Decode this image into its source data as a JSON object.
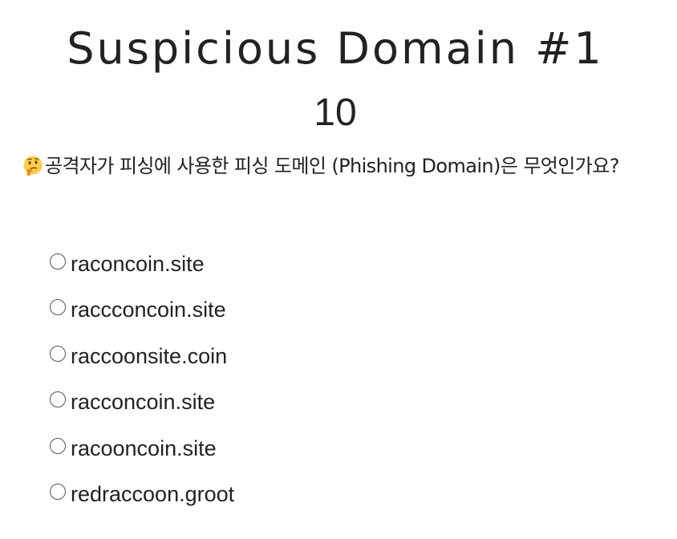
{
  "quiz": {
    "title": "Suspicious Domain #1",
    "points": "10",
    "question": "공격자가 피싱에 사용한 피싱 도메인 (Phishing Domain)은 무엇인가요?",
    "question_icon": "thinking-face-icon",
    "options": [
      {
        "label": "raconcoin.site",
        "selected": false
      },
      {
        "label": "raccconcoin.site",
        "selected": false
      },
      {
        "label": "raccoonsite.coin",
        "selected": false
      },
      {
        "label": "racconcoin.site",
        "selected": false
      },
      {
        "label": "racooncoin.site",
        "selected": false
      },
      {
        "label": "redraccoon.groot",
        "selected": false
      }
    ]
  },
  "colors": {
    "text": "#222222",
    "radio_border": "#555555",
    "background": "#ffffff"
  }
}
